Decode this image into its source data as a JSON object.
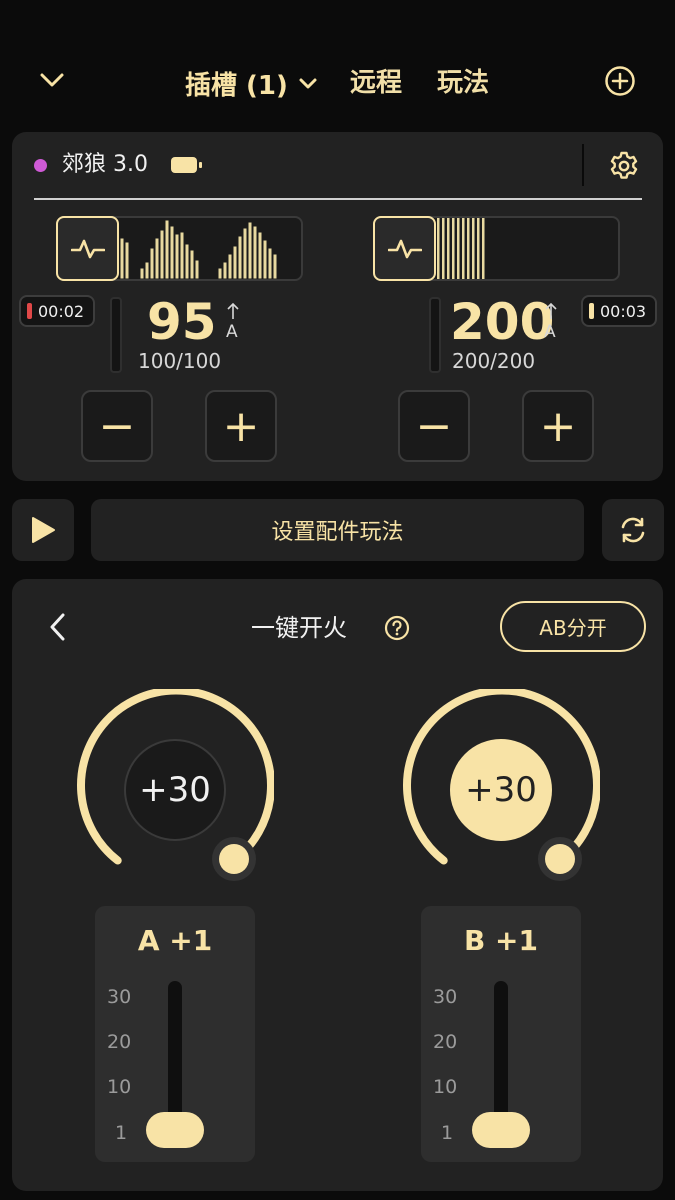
{
  "header": {
    "slot_label": "插槽 (1)",
    "remote_label": "远程",
    "play_label": "玩法"
  },
  "device": {
    "name": "郊狼 3.0",
    "status_color": "#cf5ad6"
  },
  "channel_a": {
    "timer": "00:02",
    "timer_color": "#e04848",
    "value": "95",
    "unit": "A",
    "limit": "100/100",
    "minus": "−",
    "plus": "+"
  },
  "channel_b": {
    "timer": "00:03",
    "timer_color": "#f8e3a6",
    "value": "200",
    "unit": "A",
    "limit": "200/200",
    "minus": "−",
    "plus": "+"
  },
  "actions": {
    "set_accessory_label": "设置配件玩法"
  },
  "panel": {
    "title": "一键开火",
    "ab_split_label": "AB分开",
    "knob_a": {
      "value": "+30"
    },
    "knob_b": {
      "value": "+30"
    },
    "slider_a": {
      "title": "A +1",
      "ticks": [
        "30",
        "20",
        "10",
        "1"
      ],
      "value": 1
    },
    "slider_b": {
      "title": "B +1",
      "ticks": [
        "30",
        "20",
        "10",
        "1"
      ],
      "value": 1
    }
  },
  "colors": {
    "accent": "#f8e3a6",
    "background": "#0b0b0b",
    "card": "#222222"
  }
}
